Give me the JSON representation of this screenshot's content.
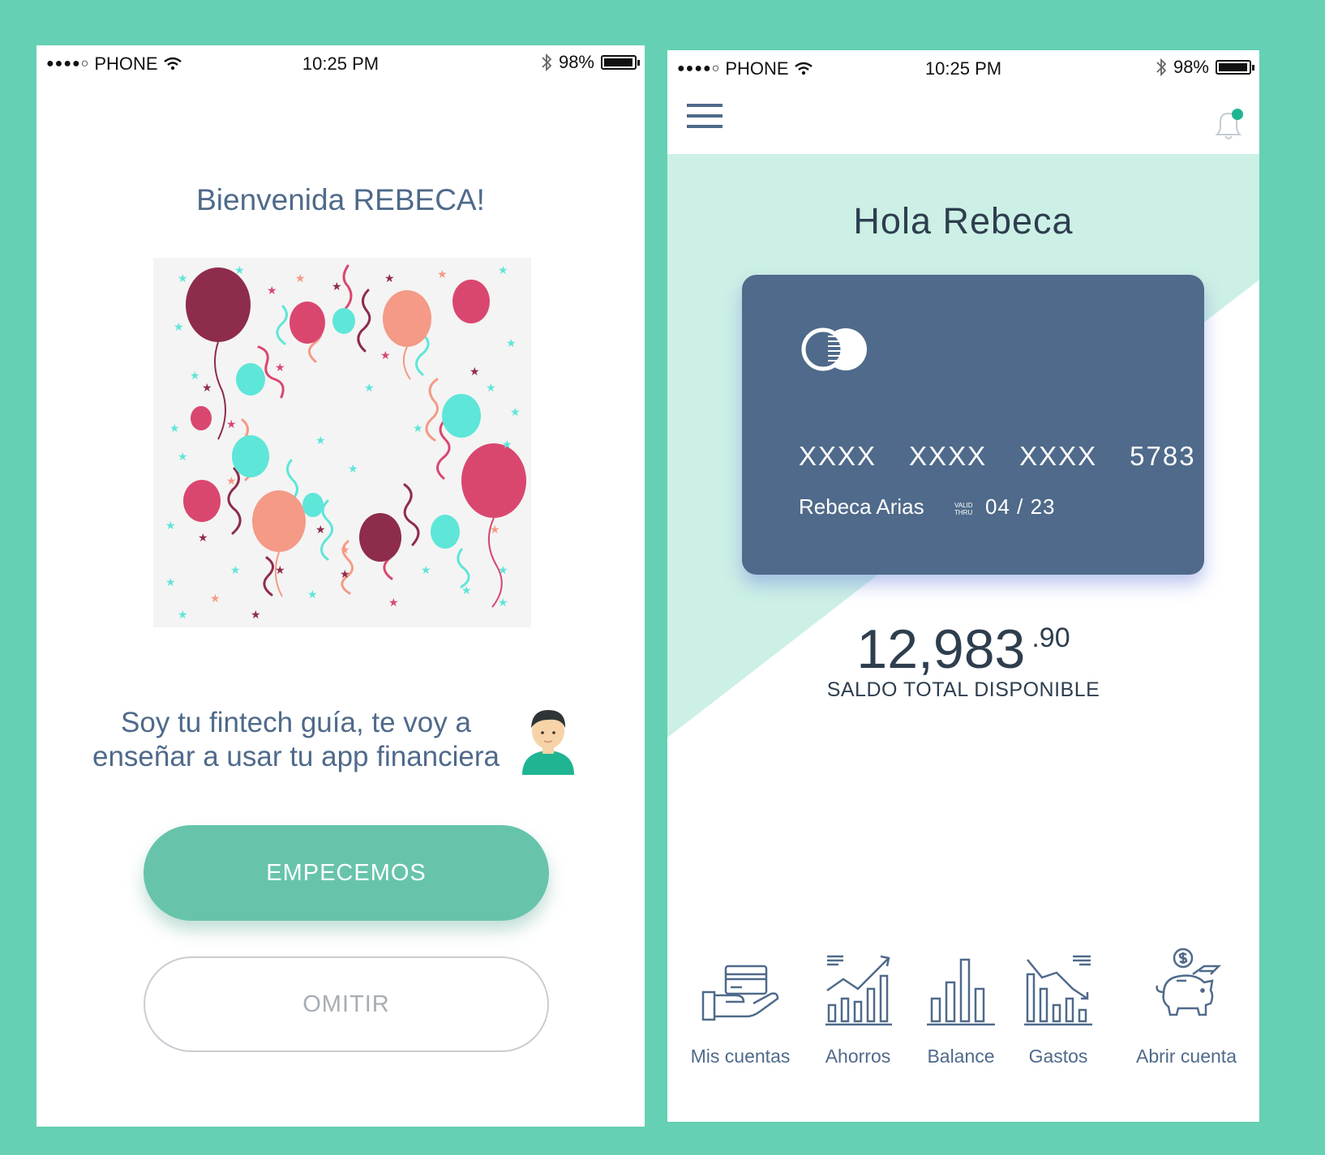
{
  "status_bar": {
    "carrier": "PHONE",
    "signal_dots": "●●●●○",
    "time": "10:25 PM",
    "battery": "98%",
    "battery_level": 0.98
  },
  "welcome_screen": {
    "title": "Bienvenida REBECA!",
    "guide_line1": "Soy tu fintech guía, te voy a",
    "guide_line2": "enseñar a usar tu app financiera",
    "primary_button": "EMPECEMOS",
    "secondary_button": "OMITIR"
  },
  "home_screen": {
    "greeting": "Hola Rebeca",
    "card": {
      "number_groups": [
        "XXXX",
        "XXXX",
        "XXXX",
        "5783"
      ],
      "holder": "Rebeca Arias",
      "valid_label_1": "VALID",
      "valid_label_2": "THRU",
      "expiry": "04 / 23"
    },
    "balance_whole": "12,983",
    "balance_cents": ".90",
    "balance_label": "SALDO TOTAL DISPONIBLE",
    "nav": [
      {
        "label": "Mis cuentas",
        "icon": "hand-card-icon"
      },
      {
        "label": "Ahorros",
        "icon": "rising-chart-icon"
      },
      {
        "label": "Balance",
        "icon": "bar-chart-icon"
      },
      {
        "label": "Gastos",
        "icon": "falling-chart-icon"
      },
      {
        "label": "Abrir cuenta",
        "icon": "piggy-bank-icon"
      }
    ]
  },
  "colors": {
    "background": "#65d0b4",
    "primary": "#67c4ab",
    "text": "#4f6a8a",
    "card": "#4f6a8a",
    "hero": "#ccf0e6"
  }
}
